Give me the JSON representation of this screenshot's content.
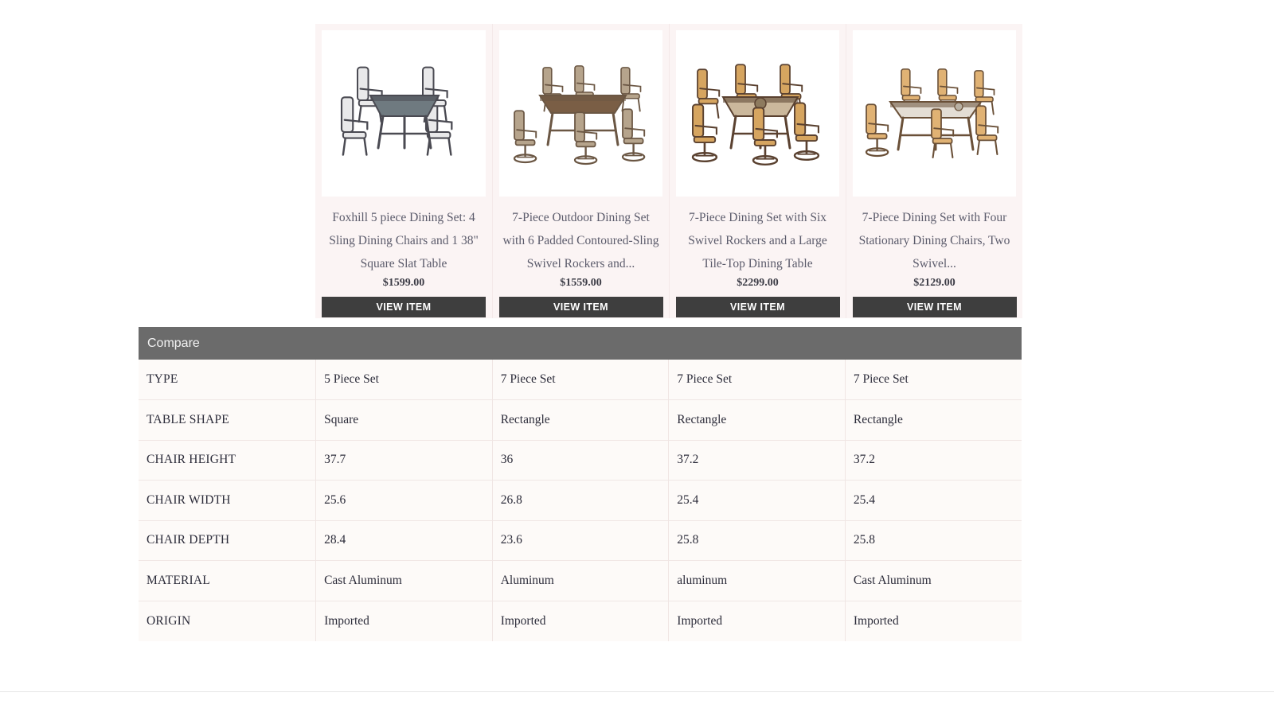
{
  "products": [
    {
      "title": "Foxhill 5 piece Dining Set: 4 Sling Dining Chairs and 1 38\" Square Slat Table",
      "price": "$1599.00",
      "button_label": "VIEW ITEM",
      "image_name": "patio-dining-set-square-glass-table-four-white-sling-chairs",
      "frame_color": "#4a4a52",
      "sling_color": "#e9e9ea"
    },
    {
      "title": "7-Piece Outdoor Dining Set with 6 Padded Contoured-Sling Swivel Rockers and...",
      "price": "$1559.00",
      "button_label": "VIEW ITEM",
      "image_name": "patio-dining-set-rectangular-slat-table-six-padded-swivel-rockers",
      "frame_color": "#6b5744",
      "sling_color": "#b6a48c"
    },
    {
      "title": "7-Piece Dining Set with Six Swivel Rockers and a Large Tile-Top Dining Table",
      "price": "$2299.00",
      "button_label": "VIEW ITEM",
      "image_name": "patio-dining-set-tile-top-table-six-tan-swivel-rockers",
      "frame_color": "#5a4130",
      "sling_color": "#d6a560"
    },
    {
      "title": "7-Piece Dining Set with Four Stationary Dining Chairs, Two Swivel...",
      "price": "$2129.00",
      "button_label": "VIEW ITEM",
      "image_name": "patio-dining-set-glass-top-table-stationary-and-swivel-chairs",
      "frame_color": "#6a5038",
      "sling_color": "#e0b274"
    }
  ],
  "compare": {
    "header_label": "Compare",
    "rows": [
      {
        "label": "TYPE",
        "values": [
          "5 Piece Set",
          "7 Piece Set",
          "7 Piece Set",
          "7 Piece Set"
        ]
      },
      {
        "label": "TABLE SHAPE",
        "values": [
          "Square",
          "Rectangle",
          "Rectangle",
          "Rectangle"
        ]
      },
      {
        "label": "CHAIR HEIGHT",
        "values": [
          "37.7",
          "36",
          "37.2",
          "37.2"
        ]
      },
      {
        "label": "CHAIR WIDTH",
        "values": [
          "25.6",
          "26.8",
          "25.4",
          "25.4"
        ]
      },
      {
        "label": "CHAIR DEPTH",
        "values": [
          "28.4",
          "23.6",
          "25.8",
          "25.8"
        ]
      },
      {
        "label": "MATERIAL",
        "values": [
          "Cast Aluminum",
          "Aluminum",
          "aluminum",
          "Cast Aluminum"
        ]
      },
      {
        "label": "ORIGIN",
        "values": [
          "Imported",
          "Imported",
          "Imported",
          "Imported"
        ]
      }
    ]
  },
  "colors": {
    "card_background": "#fbf4f4",
    "image_background": "#ffffff",
    "button_background": "#3e3e3e",
    "compare_header_background": "#6b6b6b",
    "table_background": "#fdfaf8",
    "table_border": "#f0e6e4",
    "title_text": "#5b5b6b"
  }
}
